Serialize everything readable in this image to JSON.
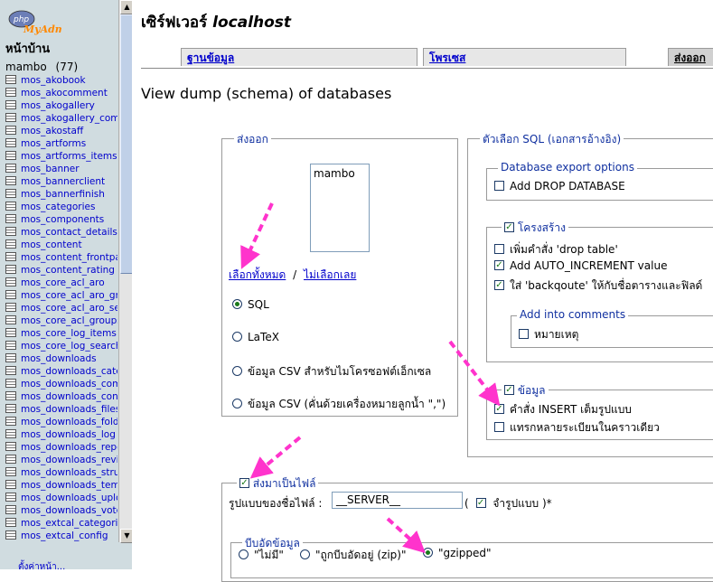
{
  "sidebar": {
    "home_label": "หน้าบ้าน",
    "db_name": "mambo",
    "db_count": "(77)",
    "tables": [
      "mos_akobook",
      "mos_akocomment",
      "mos_akogallery",
      "mos_akogallery_comm",
      "mos_akostaff",
      "mos_artforms",
      "mos_artforms_items",
      "mos_banner",
      "mos_bannerclient",
      "mos_bannerfinish",
      "mos_categories",
      "mos_components",
      "mos_contact_details",
      "mos_content",
      "mos_content_frontpag",
      "mos_content_rating",
      "mos_core_acl_aro",
      "mos_core_acl_aro_gro",
      "mos_core_acl_aro_sec",
      "mos_core_acl_groups_",
      "mos_core_log_items",
      "mos_core_log_searche",
      "mos_downloads",
      "mos_downloads_categ",
      "mos_downloads_comm",
      "mos_downloads_conta",
      "mos_downloads_files",
      "mos_downloads_folde",
      "mos_downloads_log",
      "mos_downloads_repos",
      "mos_downloads_revie",
      "mos_downloads_struc",
      "mos_downloads_temp",
      "mos_downloads_uploa",
      "mos_downloads_votes",
      "mos_extcal_categorie",
      "mos_extcal_config"
    ],
    "bottom_link": "ตั้งค่าหน้า..."
  },
  "header": {
    "title_prefix": "เซิร์ฟเวอร์",
    "title_host": "localhost"
  },
  "tabs": [
    {
      "label": "ฐานข้อมูล"
    },
    {
      "label": "โพรเซส"
    },
    {
      "label": "ส่งออก"
    }
  ],
  "page": {
    "subtitle": "View dump (schema) of databases"
  },
  "export_box": {
    "legend": "ส่งออก",
    "db_options": [
      "mambo"
    ],
    "select_all": "เลือกทั้งหมด",
    "separator": "/",
    "deselect_all": "ไม่เลือกเลย",
    "formats": [
      {
        "label": "SQL",
        "checked": true
      },
      {
        "label": "LaTeX",
        "checked": false
      },
      {
        "label": "ข้อมูล CSV สำหรับไมโครซอฟต์เอ็กเซล",
        "checked": false
      },
      {
        "label": "ข้อมูล CSV (คั่นด้วยเครื่องหมายลูกน้ำ \",\")",
        "checked": false
      }
    ]
  },
  "sql_options": {
    "legend": "ตัวเลือก SQL (เอกสารอ้างอิง)",
    "db_export": {
      "legend": "Database export options",
      "add_drop_database": "Add DROP DATABASE"
    },
    "structure": {
      "legend": "โครงสร้าง",
      "drop_table": "เพิ่มคำสั่ง 'drop table'",
      "auto_increment": "Add AUTO_INCREMENT value",
      "backquote": "ใส่ 'backqoute' ให้กับชื่อตารางและฟิลด์",
      "comments_legend": "Add into comments",
      "notes": "หมายเหตุ"
    },
    "data": {
      "legend": "ข้อมูล",
      "complete_insert": "คำสั่ง INSERT เต็มรูปแบบ",
      "extended_insert": "แทรกหลายระเบียนในคราวเดียว"
    }
  },
  "save_as_file": {
    "legend": "ส่งมาเป็นไฟล์",
    "filename_label": "รูปแบบของชื่อไฟล์ :",
    "filename_value": "__SERVER__",
    "paren_open": "(",
    "remember_label": "จำรูปแบบ",
    "paren_close": ")*",
    "compression": {
      "legend": "บีบอัดข้อมูล",
      "options": [
        {
          "label": "\"ไม่มี\"",
          "checked": false
        },
        {
          "label": "\"ถูกบีบอัดอยู่ (zip)\"",
          "checked": false
        },
        {
          "label": "\"gzipped\"",
          "checked": true
        }
      ]
    }
  },
  "logo": {
    "text_top": "php",
    "text_bottom": "MyAdmin"
  },
  "colors": {
    "sidebar_bg": "#d0dce0",
    "link": "#0000cc",
    "arrow": "#ff33cc",
    "check": "#1a7a1a"
  }
}
